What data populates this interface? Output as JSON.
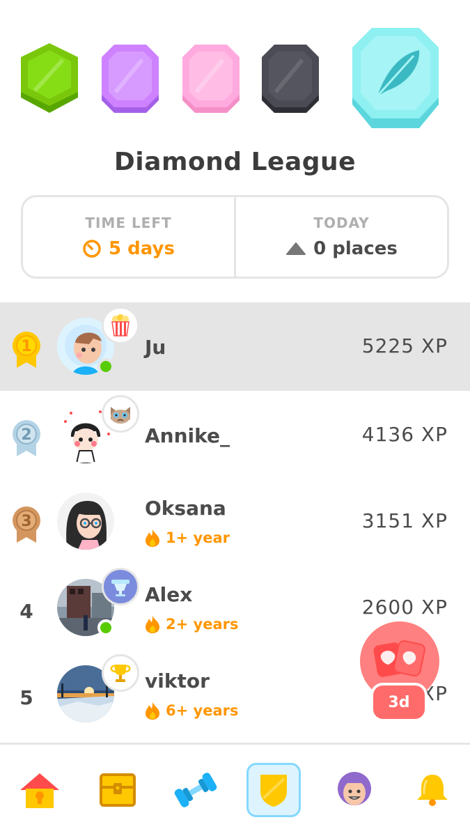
{
  "league": {
    "title": "Diamond League",
    "badges": [
      {
        "name": "bronze-league-icon",
        "color": "#7ac70c"
      },
      {
        "name": "silver-league-icon",
        "color": "#ce82ff"
      },
      {
        "name": "gold-league-icon",
        "color": "#ffaade"
      },
      {
        "name": "obsidian-league-icon",
        "color": "#4b4b55"
      },
      {
        "name": "diamond-league-icon",
        "color": "#8ff0f2"
      }
    ]
  },
  "stats": {
    "time_left_label": "TIME LEFT",
    "time_left_value": "5 days",
    "today_label": "TODAY",
    "today_value": "0 places"
  },
  "leaderboard": [
    {
      "rank": "1",
      "name": "Ju",
      "xp": "5225 XP",
      "streak": "",
      "online": true,
      "highlight": true,
      "frame": "popcorn-icon"
    },
    {
      "rank": "2",
      "name": "Annike_",
      "xp": "4136 XP",
      "streak": "",
      "online": false,
      "highlight": false,
      "frame": "cat-icon"
    },
    {
      "rank": "3",
      "name": "Oksana",
      "xp": "3151 XP",
      "streak": "1+ year",
      "online": false,
      "highlight": false,
      "frame": ""
    },
    {
      "rank": "4",
      "name": "Alex",
      "xp": "2600 XP",
      "streak": "2+ years",
      "online": true,
      "highlight": false,
      "frame": "trophy-cup-icon"
    },
    {
      "rank": "5",
      "name": "viktor",
      "xp": "XP",
      "streak": "6+ years",
      "online": false,
      "highlight": false,
      "frame": "gold-trophy-icon"
    }
  ],
  "float_badge": {
    "label": "3d",
    "icon": "clapping-hands-icon"
  },
  "tabs": [
    {
      "name": "tab-home",
      "icon": "house-icon"
    },
    {
      "name": "tab-chest",
      "icon": "treasure-chest-icon"
    },
    {
      "name": "tab-practice",
      "icon": "dumbbell-icon"
    },
    {
      "name": "tab-leagues",
      "icon": "shield-icon",
      "active": true
    },
    {
      "name": "tab-profile",
      "icon": "avatar-icon"
    },
    {
      "name": "tab-notifications",
      "icon": "bell-icon"
    }
  ],
  "colors": {
    "accent_orange": "#ff9600",
    "highlight_row": "#e5e5e5",
    "online_green": "#58cc02",
    "active_tab_bg": "#ddf4ff"
  }
}
